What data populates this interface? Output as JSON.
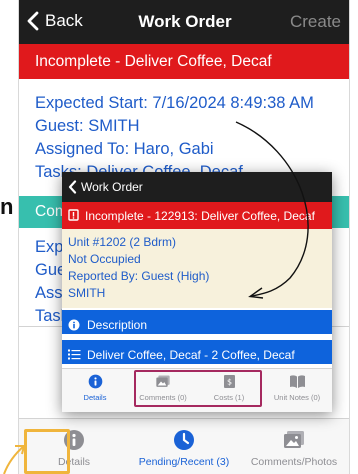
{
  "navbar": {
    "back_label": "Back",
    "title": "Work Order",
    "create_label": "Create"
  },
  "status": {
    "text": "Incomplete - Deliver Coffee, Decaf"
  },
  "details": {
    "expected_start": "Expected Start: 7/16/2024 8:49:38 AM",
    "guest": "Guest: SMITH",
    "assigned_to": "Assigned To: Haro, Gabi",
    "tasks": "Tasks: Deliver Coffee, Decaf"
  },
  "comments_bar": {
    "label": "Com"
  },
  "peek_lines": [
    "Expe",
    "Gues",
    "Assi",
    "Task"
  ],
  "edge_letter": "n",
  "tabs": [
    {
      "label": "Details",
      "icon": "info-icon"
    },
    {
      "label": "Pending/Recent (3)",
      "icon": "clock-icon"
    },
    {
      "label": "Comments/Photos",
      "icon": "photo-icon"
    }
  ],
  "modal": {
    "nav_title": "Work Order",
    "status_text": "Incomplete - 122913: Deliver Coffee, Decaf",
    "info": [
      "Unit #1202 (2 Bdrm)",
      "Not Occupied",
      "Reported By: Guest  (High)",
      "SMITH"
    ],
    "description_label": "Description",
    "task_line": "Deliver Coffee, Decaf - 2 Coffee, Decaf",
    "tabs": [
      {
        "label": "Details",
        "icon": "info-icon"
      },
      {
        "label": "Comments (0)",
        "icon": "photo-icon"
      },
      {
        "label": "Costs (1)",
        "icon": "receipt-icon"
      },
      {
        "label": "Unit Notes (0)",
        "icon": "book-icon"
      }
    ]
  },
  "colors": {
    "navbar": "#1e1e1e",
    "status_red": "#e0191c",
    "link_blue": "#1f5cc9",
    "teal": "#37bfae",
    "tab_active": "#1a62d6",
    "highlight_yellow": "#f0b53c",
    "highlight_magenta": "#a5295f"
  }
}
